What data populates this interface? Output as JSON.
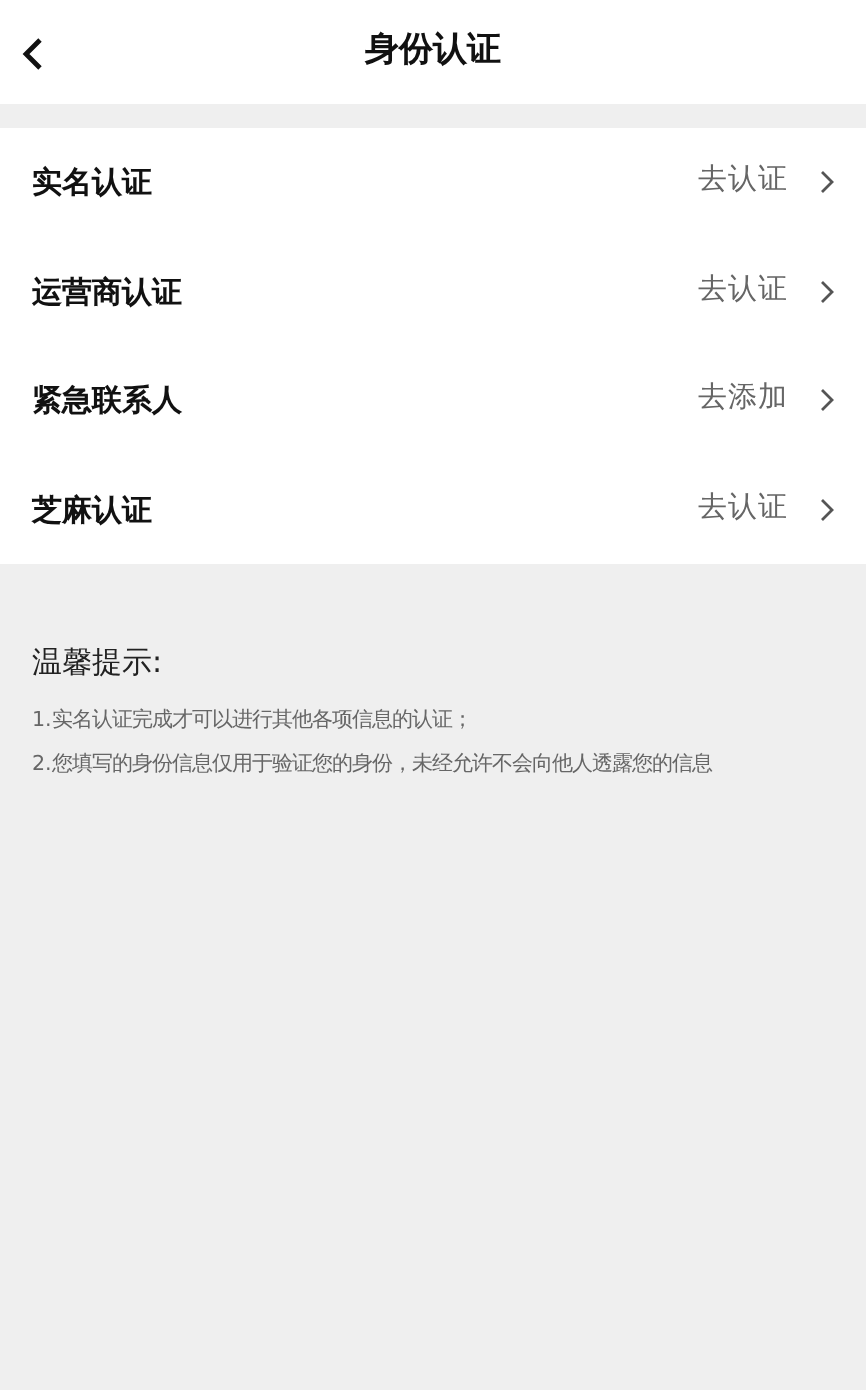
{
  "header": {
    "title": "身份认证"
  },
  "items": [
    {
      "label": "实名认证",
      "action": "去认证"
    },
    {
      "label": "运营商认证",
      "action": "去认证"
    },
    {
      "label": "紧急联系人",
      "action": "去添加"
    },
    {
      "label": "芝麻认证",
      "action": "去认证"
    }
  ],
  "tips": {
    "title": "温馨提示:",
    "lines": [
      "1.实名认证完成才可以进行其他各项信息的认证；",
      "2.您填写的身份信息仅用于验证您的身份，未经允许不会向他人透露您的信息"
    ]
  }
}
